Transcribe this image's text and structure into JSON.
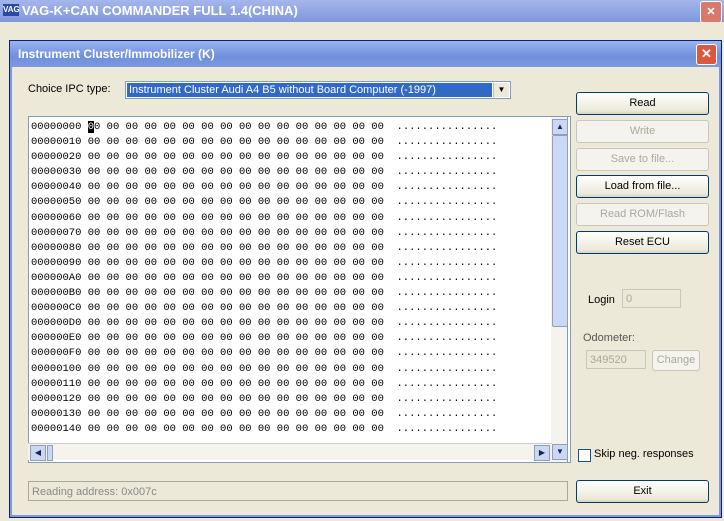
{
  "app": {
    "title": "VAG-K+CAN COMMANDER FULL 1.4(CHINA)",
    "icon_text": "VAG"
  },
  "dialog": {
    "title": "Instrument Cluster/Immobilizer (K)",
    "ipc_label": "Choice IPC type:",
    "ipc_selected": "Instrument Cluster Audi A4 B5 without Board Computer  (-1997)"
  },
  "hex": {
    "rows": [
      {
        "addr": "00000000",
        "bytes": "00 00 00 00 00 00 00 00 00 00 00 00 00 00 00 00",
        "ascii": "................"
      },
      {
        "addr": "00000010",
        "bytes": "00 00 00 00 00 00 00 00 00 00 00 00 00 00 00 00",
        "ascii": "................"
      },
      {
        "addr": "00000020",
        "bytes": "00 00 00 00 00 00 00 00 00 00 00 00 00 00 00 00",
        "ascii": "................"
      },
      {
        "addr": "00000030",
        "bytes": "00 00 00 00 00 00 00 00 00 00 00 00 00 00 00 00",
        "ascii": "................"
      },
      {
        "addr": "00000040",
        "bytes": "00 00 00 00 00 00 00 00 00 00 00 00 00 00 00 00",
        "ascii": "................"
      },
      {
        "addr": "00000050",
        "bytes": "00 00 00 00 00 00 00 00 00 00 00 00 00 00 00 00",
        "ascii": "................"
      },
      {
        "addr": "00000060",
        "bytes": "00 00 00 00 00 00 00 00 00 00 00 00 00 00 00 00",
        "ascii": "................"
      },
      {
        "addr": "00000070",
        "bytes": "00 00 00 00 00 00 00 00 00 00 00 00 00 00 00 00",
        "ascii": "................"
      },
      {
        "addr": "00000080",
        "bytes": "00 00 00 00 00 00 00 00 00 00 00 00 00 00 00 00",
        "ascii": "................"
      },
      {
        "addr": "00000090",
        "bytes": "00 00 00 00 00 00 00 00 00 00 00 00 00 00 00 00",
        "ascii": "................"
      },
      {
        "addr": "000000A0",
        "bytes": "00 00 00 00 00 00 00 00 00 00 00 00 00 00 00 00",
        "ascii": "................"
      },
      {
        "addr": "000000B0",
        "bytes": "00 00 00 00 00 00 00 00 00 00 00 00 00 00 00 00",
        "ascii": "................"
      },
      {
        "addr": "000000C0",
        "bytes": "00 00 00 00 00 00 00 00 00 00 00 00 00 00 00 00",
        "ascii": "................"
      },
      {
        "addr": "000000D0",
        "bytes": "00 00 00 00 00 00 00 00 00 00 00 00 00 00 00 00",
        "ascii": "................"
      },
      {
        "addr": "000000E0",
        "bytes": "00 00 00 00 00 00 00 00 00 00 00 00 00 00 00 00",
        "ascii": "................"
      },
      {
        "addr": "000000F0",
        "bytes": "00 00 00 00 00 00 00 00 00 00 00 00 00 00 00 00",
        "ascii": "................"
      },
      {
        "addr": "00000100",
        "bytes": "00 00 00 00 00 00 00 00 00 00 00 00 00 00 00 00",
        "ascii": "................"
      },
      {
        "addr": "00000110",
        "bytes": "00 00 00 00 00 00 00 00 00 00 00 00 00 00 00 00",
        "ascii": "................"
      },
      {
        "addr": "00000120",
        "bytes": "00 00 00 00 00 00 00 00 00 00 00 00 00 00 00 00",
        "ascii": "................"
      },
      {
        "addr": "00000130",
        "bytes": "00 00 00 00 00 00 00 00 00 00 00 00 00 00 00 00",
        "ascii": "................"
      },
      {
        "addr": "00000140",
        "bytes": "00 00 00 00 00 00 00 00 00 00 00 00 00 00 00 00",
        "ascii": "................"
      }
    ]
  },
  "buttons": {
    "read": "Read",
    "write": "Write",
    "save": "Save to file...",
    "load": "Load from file...",
    "read_rom": "Read ROM/Flash",
    "reset_ecu": "Reset ECU",
    "change": "Change",
    "exit": "Exit"
  },
  "login": {
    "label": "Login",
    "value": "0"
  },
  "odometer": {
    "label": "Odometer:",
    "value": "349520"
  },
  "skip_neg": {
    "label": "Skip neg. responses",
    "checked": false
  },
  "status": {
    "text": "Reading address: 0x007c"
  },
  "colors": {
    "title_bar": "#7f97dc",
    "selection": "#316ac5",
    "close_button": "#d9593e"
  }
}
